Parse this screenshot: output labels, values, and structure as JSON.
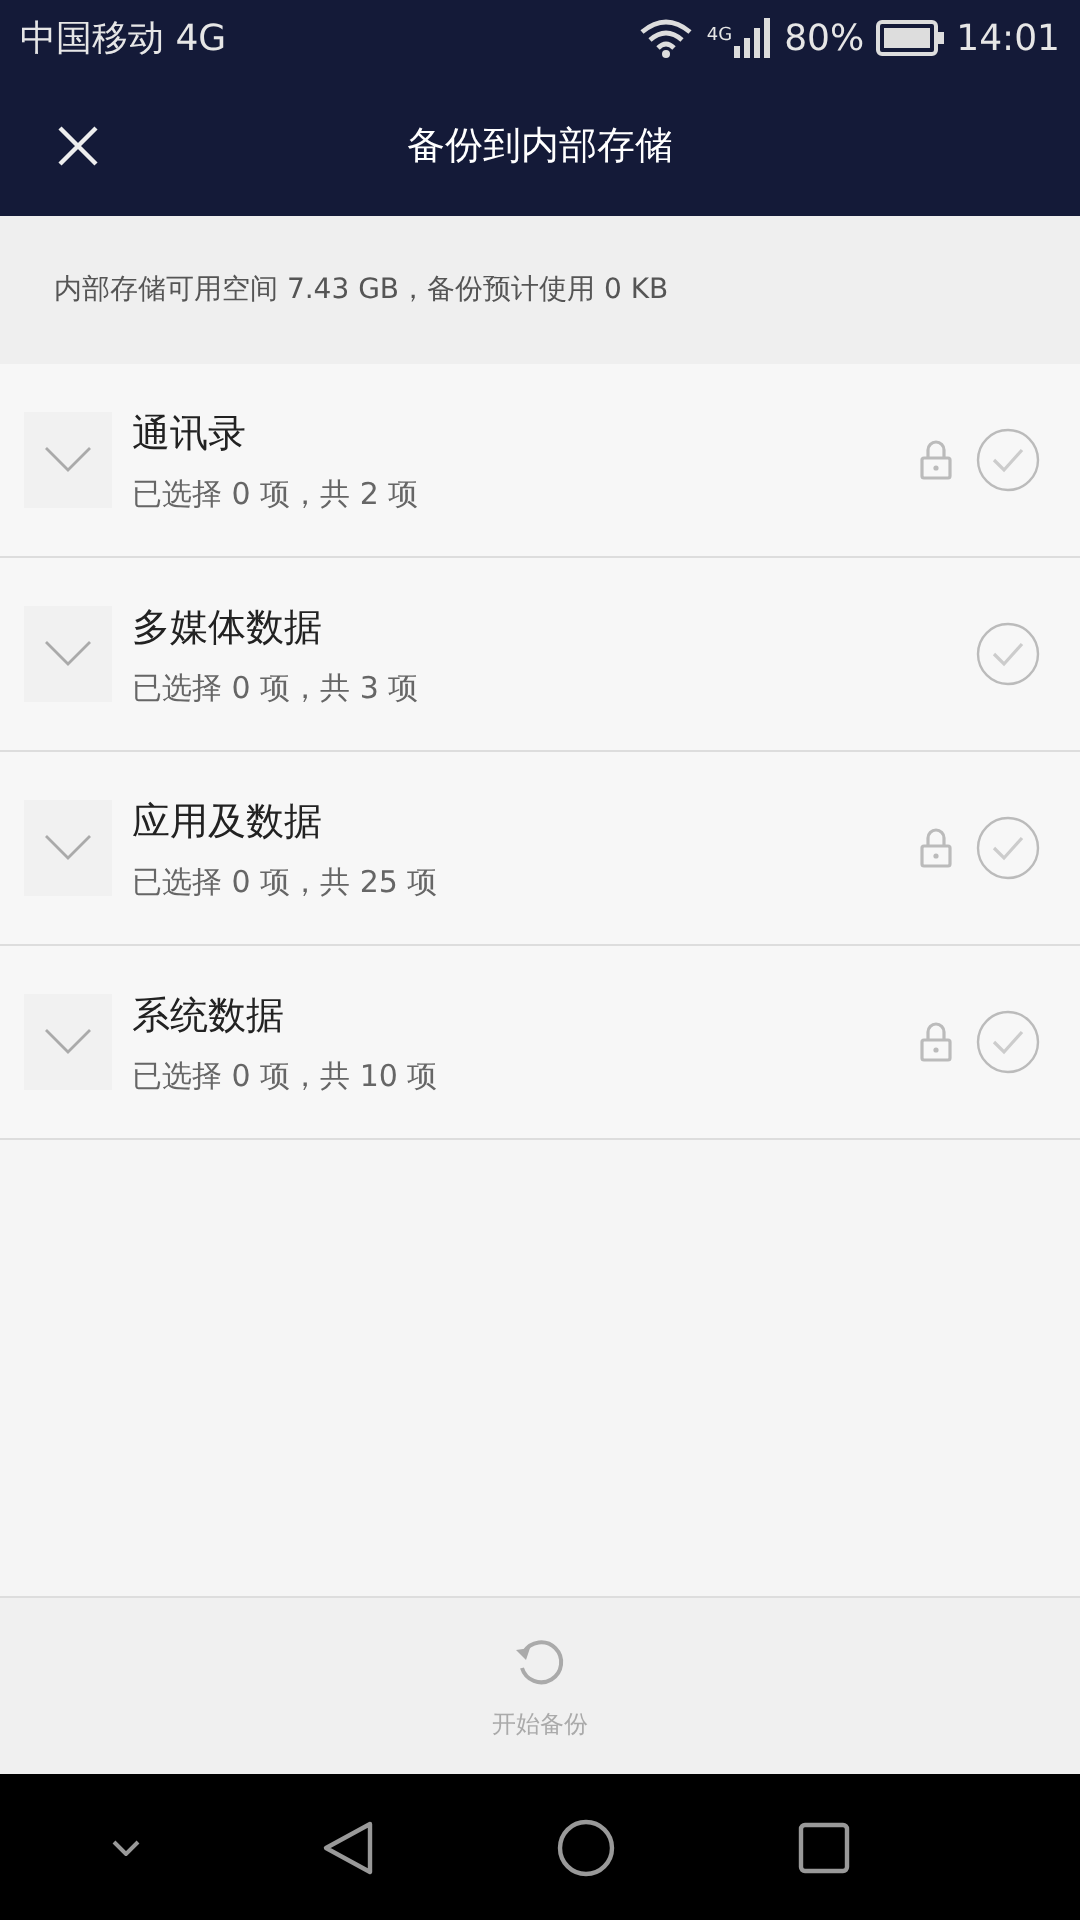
{
  "status_bar": {
    "carrier": "中国移动 4G",
    "network_badge": "4G",
    "battery": "80%",
    "time": "14:01"
  },
  "toolbar": {
    "title": "备份到内部存储"
  },
  "storage_info": "内部存储可用空间 7.43 GB，备份预计使用 0 KB",
  "categories": [
    {
      "name": "通讯录",
      "summary": "已选择 0 项，共 2 项",
      "locked": true,
      "checked": false,
      "expanded": false
    },
    {
      "name": "多媒体数据",
      "summary": "已选择 0 项，共 3 项",
      "locked": false,
      "checked": false,
      "expanded": false
    },
    {
      "name": "应用及数据",
      "summary": "已选择 0 项，共 25 项",
      "locked": true,
      "checked": false,
      "expanded": false
    },
    {
      "name": "系统数据",
      "summary": "已选择 0 项，共 10 项",
      "locked": true,
      "checked": false,
      "expanded": false
    }
  ],
  "start_button": {
    "label": "开始备份",
    "disabled": true
  }
}
